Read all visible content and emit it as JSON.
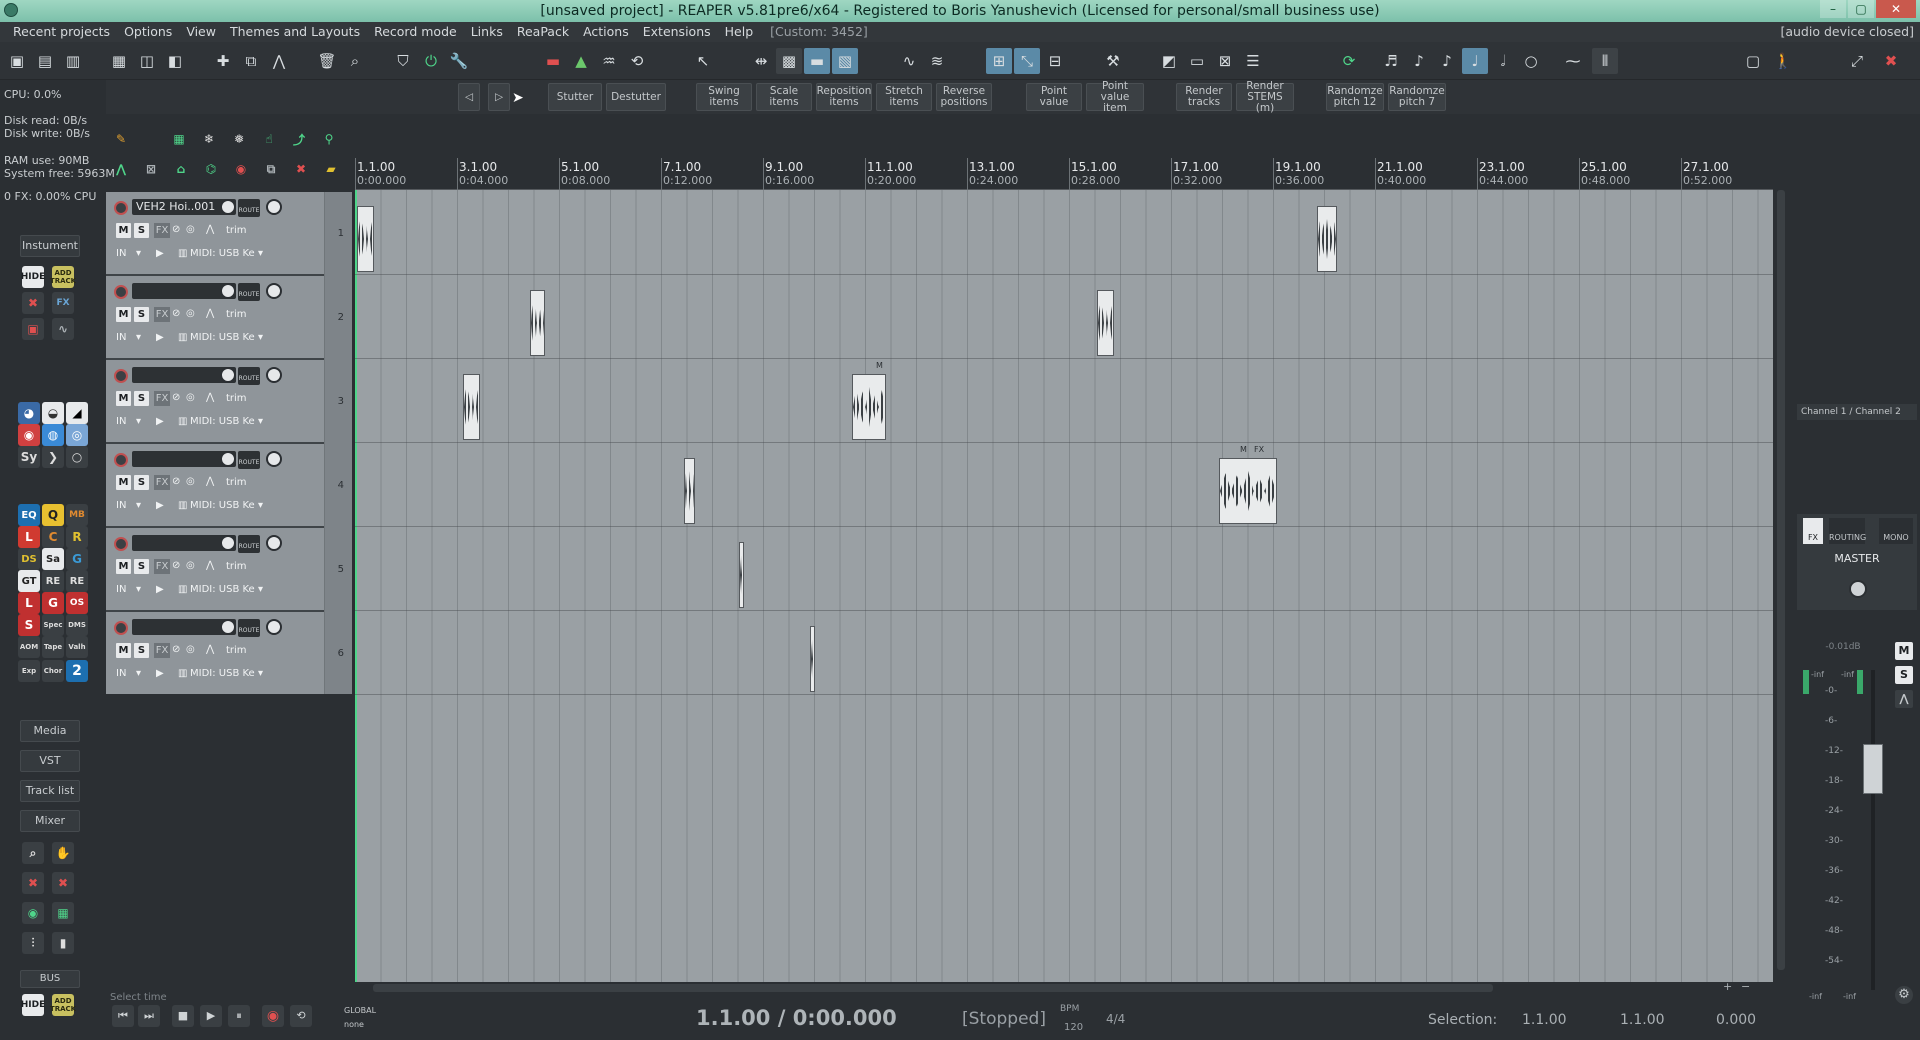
{
  "window": {
    "title": "[unsaved project] - REAPER v5.81pre6/x64 - Registered to Boris Yanushevich (Licensed for personal/small business use)"
  },
  "menu": {
    "items": [
      "Recent projects",
      "Options",
      "View",
      "Themes and Layouts",
      "Record mode",
      "Links",
      "ReaPack",
      "Actions",
      "Extensions",
      "Help"
    ],
    "custom": "[Custom: 3452]",
    "audio_status": "[audio device closed]"
  },
  "actions": {
    "stutter": "Stutter",
    "destutter": "Destutter",
    "swing": "Swing items",
    "scale": "Scale items",
    "reposition": "Reposition items",
    "stretch": "Stretch items",
    "reverse": "Reverse positions",
    "point_value": "Point value",
    "point_value_item": "Point value item",
    "render_tracks": "Render tracks",
    "render_stems": "Render STEMS (m)",
    "rand12": "Randomze pitch 12",
    "rand7": "Randomze pitch 7"
  },
  "stats": {
    "cpu": "CPU: 0.0%",
    "disk_read": "Disk read: 0B/s",
    "disk_write": "Disk write: 0B/s",
    "ram": "RAM use: 90MB",
    "system_free": "System free: 5963M",
    "fx_cpu": "0 FX: 0.00% CPU"
  },
  "left": {
    "instrument": "Instument",
    "hide": "HIDE",
    "add": "ADD",
    "track": "TRACK",
    "media": "Media",
    "vst": "VST",
    "tracklist": "Track list",
    "mixer": "Mixer",
    "bus": "BUS",
    "hide2": "HIDE",
    "add2": "ADD",
    "track2": "TRACK"
  },
  "tracks": [
    {
      "name": "VEH2 Hoi..001",
      "num": "1",
      "m": "M",
      "s": "S",
      "fx": "FX",
      "trim": "trim",
      "input": "IN",
      "midi": "MIDI: USB Ke",
      "route": "ROUTE"
    },
    {
      "name": "",
      "num": "2",
      "m": "M",
      "s": "S",
      "fx": "FX",
      "trim": "trim",
      "input": "IN",
      "midi": "MIDI: USB Ke",
      "route": "ROUTE"
    },
    {
      "name": "",
      "num": "3",
      "m": "M",
      "s": "S",
      "fx": "FX",
      "trim": "trim",
      "input": "IN",
      "midi": "MIDI: USB Ke",
      "route": "ROUTE"
    },
    {
      "name": "",
      "num": "4",
      "m": "M",
      "s": "S",
      "fx": "FX",
      "trim": "trim",
      "input": "IN",
      "midi": "MIDI: USB Ke",
      "route": "ROUTE"
    },
    {
      "name": "",
      "num": "5",
      "m": "M",
      "s": "S",
      "fx": "FX",
      "trim": "trim",
      "input": "IN",
      "midi": "MIDI: USB Ke",
      "route": "ROUTE"
    },
    {
      "name": "",
      "num": "6",
      "m": "M",
      "s": "S",
      "fx": "FX",
      "trim": "trim",
      "input": "IN",
      "midi": "MIDI: USB Ke",
      "route": "ROUTE"
    }
  ],
  "ruler": {
    "bars": [
      "1.1.00",
      "3.1.00",
      "5.1.00",
      "7.1.00",
      "9.1.00",
      "11.1.00",
      "13.1.00",
      "15.1.00",
      "17.1.00",
      "19.1.00",
      "21.1.00",
      "23.1.00",
      "25.1.00",
      "27.1.00"
    ],
    "times": [
      "0:00.000",
      "0:04.000",
      "0:08.000",
      "0:12.000",
      "0:16.000",
      "0:20.000",
      "0:24.000",
      "0:28.000",
      "0:32.000",
      "0:36.000",
      "0:40.000",
      "0:44.000",
      "0:48.000",
      "0:52.000"
    ]
  },
  "items_labels": {
    "m": "M",
    "fx": "FX"
  },
  "transport": {
    "status_text": "Select time",
    "global": "GLOBAL",
    "none": "none",
    "position": "1.1.00 / 0:00.000",
    "state": "[Stopped]",
    "bpm_label": "BPM",
    "bpm": "120",
    "timesig": "4/4",
    "selection_label": "Selection:",
    "sel_start": "1.1.00",
    "sel_end": "1.1.00",
    "sel_len": "0.000"
  },
  "mixer": {
    "channel": "Channel 1 / Channel 2",
    "fx": "FX",
    "routing": "ROUTING",
    "mono": "MONO",
    "name": "MASTER",
    "volume": "-0.01dB",
    "inf_l": "-inf",
    "inf_r": "-inf",
    "m": "M",
    "s": "S",
    "scale": [
      "-0-",
      "-6-",
      "-12-",
      "-18-",
      "-24-",
      "-30-",
      "-36-",
      "-42-",
      "-48-",
      "-54-"
    ],
    "inf_bl": "-inf",
    "inf_br": "-inf"
  }
}
